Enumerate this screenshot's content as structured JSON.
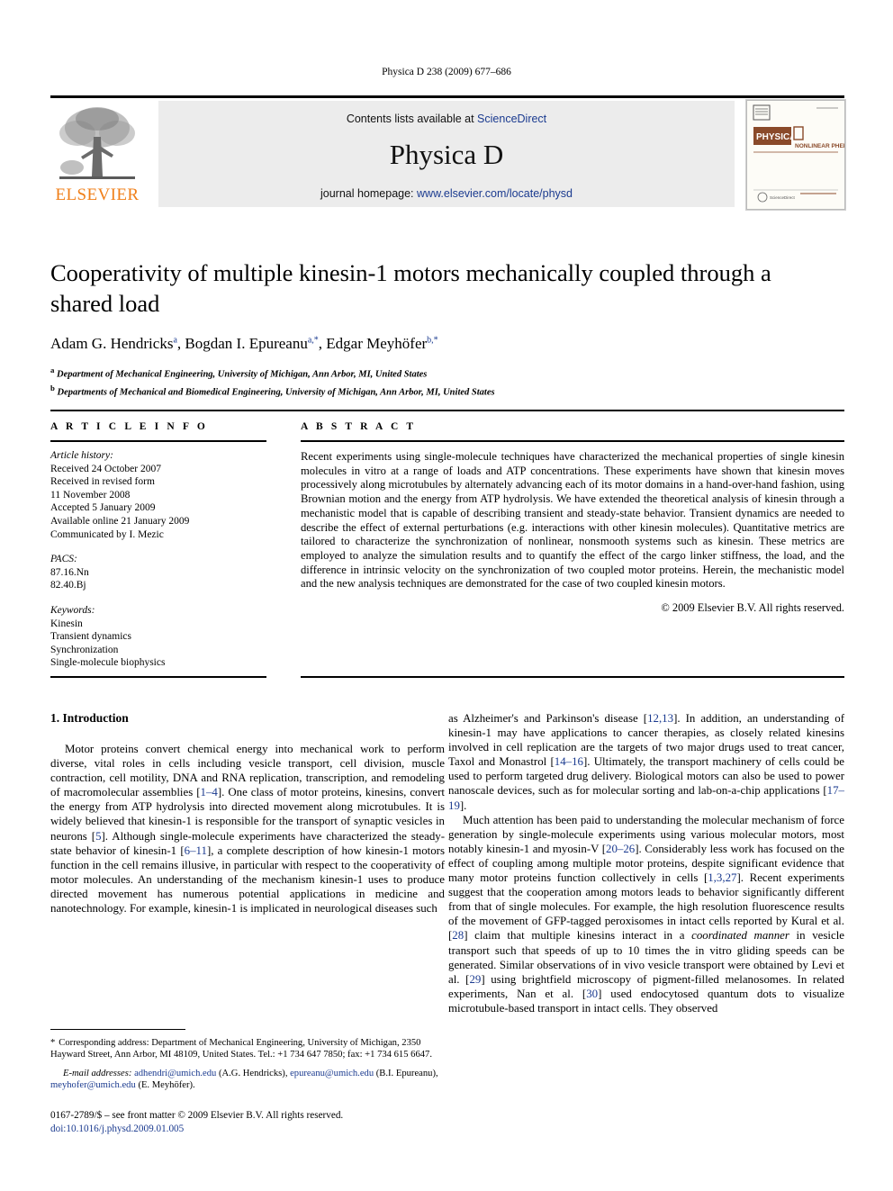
{
  "running_head": "Physica D 238 (2009) 677–686",
  "masthead": {
    "contents_prefix": "Contents lists available at ",
    "contents_link": "ScienceDirect",
    "journal_name": "Physica D",
    "homepage_prefix": "journal homepage: ",
    "homepage_link": "www.elsevier.com/locate/physd",
    "publisher_wordmark": "ELSEVIER",
    "cover": {
      "title_left": "PHYSICA",
      "title_letter": "D",
      "subtitle": "NONLINEAR PHENOMENA"
    }
  },
  "article": {
    "title": "Cooperativity of multiple kinesin-1 motors mechanically coupled through a shared load",
    "authors": [
      {
        "name": "Adam G. Hendricks",
        "sup": "a"
      },
      {
        "name": "Bogdan I. Epureanu",
        "sup": "a,*"
      },
      {
        "name": "Edgar Meyhöfer",
        "sup": "b,*"
      }
    ],
    "affiliations": [
      {
        "label": "a",
        "text": "Department of Mechanical Engineering, University of Michigan, Ann Arbor, MI, United States"
      },
      {
        "label": "b",
        "text": "Departments of Mechanical and Biomedical Engineering, University of Michigan, Ann Arbor, MI, United States"
      }
    ]
  },
  "info": {
    "heading": "A R T I C L E   I N F O",
    "history_label": "Article history:",
    "history": [
      "Received 24 October 2007",
      "Received in revised form",
      "11 November 2008",
      "Accepted 5 January 2009",
      "Available online 21 January 2009",
      "Communicated by I. Mezic"
    ],
    "pacs_label": "PACS:",
    "pacs": [
      "87.16.Nn",
      "82.40.Bj"
    ],
    "keywords_label": "Keywords:",
    "keywords": [
      "Kinesin",
      "Transient dynamics",
      "Synchronization",
      "Single-molecule biophysics"
    ]
  },
  "abstract": {
    "heading": "A B S T R A C T",
    "text": "Recent experiments using single-molecule techniques have characterized the mechanical properties of single kinesin molecules in vitro at a range of loads and ATP concentrations. These experiments have shown that kinesin moves processively along microtubules by alternately advancing each of its motor domains in a hand-over-hand fashion, using Brownian motion and the energy from ATP hydrolysis. We have extended the theoretical analysis of kinesin through a mechanistic model that is capable of describing transient and steady-state behavior. Transient dynamics are needed to describe the effect of external perturbations (e.g. interactions with other kinesin molecules). Quantitative metrics are tailored to characterize the synchronization of nonlinear, nonsmooth systems such as kinesin. These metrics are employed to analyze the simulation results and to quantify the effect of the cargo linker stiffness, the load, and the difference in intrinsic velocity on the synchronization of two coupled motor proteins. Herein, the mechanistic model and the new analysis techniques are demonstrated for the case of two coupled kinesin motors.",
    "copyright": "© 2009 Elsevier B.V. All rights reserved."
  },
  "section": {
    "number_title": "1.  Introduction"
  },
  "body": {
    "left_para_1_a": "Motor proteins convert chemical energy into mechanical work to perform diverse, vital roles in cells including vesicle transport, cell division, muscle contraction, cell motility, DNA and RNA replication, transcription, and remodeling of macromolecular assemblies [",
    "cite_1_4": "1–4",
    "left_para_1_b": "]. One class of motor proteins, kinesins, convert the energy from ATP hydrolysis into directed movement along microtubules. It is widely believed that kinesin-1 is responsible for the transport of synaptic vesicles in neurons [",
    "cite_5": "5",
    "left_para_1_c": "]. Although single-molecule experiments have characterized the steady-state behavior of kinesin-1 [",
    "cite_6_11": "6–11",
    "left_para_1_d": "], a complete description of how kinesin-1 motors function in the cell remains illusive, in particular with respect to the cooperativity of motor molecules. An understanding of the mechanism kinesin-1 uses to produce directed movement has numerous potential applications in medicine and nanotechnology. For example, kinesin-1 is implicated in neurological diseases such",
    "right_para_1_a": "as Alzheimer's and Parkinson's disease [",
    "cite_12_13": "12,13",
    "right_para_1_b": "]. In addition, an understanding of kinesin-1 may have applications to cancer therapies, as closely related kinesins involved in cell replication are the targets of two major drugs used to treat cancer, Taxol and Monastrol [",
    "cite_14_16": "14–16",
    "right_para_1_c": "]. Ultimately, the transport machinery of cells could be used to perform targeted drug delivery. Biological motors can also be used to power nanoscale devices, such as for molecular sorting and lab-on-a-chip applications [",
    "cite_17_19": "17–19",
    "right_para_1_d": "].",
    "right_para_2_a": "Much attention has been paid to understanding the molecular mechanism of force generation by single-molecule experiments using various molecular motors, most notably kinesin-1 and myosin-V [",
    "cite_20_26": "20–26",
    "right_para_2_b": "]. Considerably less work has focused on the effect of coupling among multiple motor proteins, despite significant evidence that many motor proteins function collectively in cells [",
    "cite_1_3_27": "1,3,27",
    "right_para_2_c": "]. Recent experiments suggest that the cooperation among motors leads to behavior significantly different from that of single molecules. For example, the high resolution fluorescence results of the movement of GFP-tagged peroxisomes in intact cells reported by Kural et al. [",
    "cite_28": "28",
    "right_para_2_d": "] claim that multiple kinesins interact in a ",
    "emph_coordinated": "coordinated manner",
    "right_para_2_e": " in vesicle transport such that speeds of up to 10 times the in vitro gliding speeds can be generated. Similar observations of in vivo vesicle transport were obtained by Levi et al. [",
    "cite_29": "29",
    "right_para_2_f": "] using brightfield microscopy of pigment-filled melanosomes. In related experiments, Nan et al. [",
    "cite_30": "30",
    "right_para_2_g": "] used endocytosed quantum dots to visualize microtubule-based transport in intact cells. They observed"
  },
  "footnotes": {
    "corresponding_marker": "*",
    "corresponding": "Corresponding address: Department of Mechanical Engineering, University of Michigan, 2350 Hayward Street, Ann Arbor, MI 48109, United States. Tel.: +1 734 647 7850; fax: +1 734 615 6647.",
    "email_label": "E-mail addresses:",
    "emails": [
      {
        "address": "adhendri@umich.edu",
        "owner": "(A.G. Hendricks)"
      },
      {
        "address": "epureanu@umich.edu",
        "owner": "(B.I. Epureanu)"
      },
      {
        "address": "meyhofer@umich.edu",
        "owner": "(E. Meyhöfer)"
      }
    ]
  },
  "footer": {
    "issn_line": "0167-2789/$ – see front matter © 2009 Elsevier B.V. All rights reserved.",
    "doi": "doi:10.1016/j.physd.2009.01.005"
  },
  "colors": {
    "link_blue": "#1a3a8f",
    "elsevier_orange": "#F07F19",
    "panel_gray": "#ececec",
    "cover_brown": "#8a4a2a"
  }
}
